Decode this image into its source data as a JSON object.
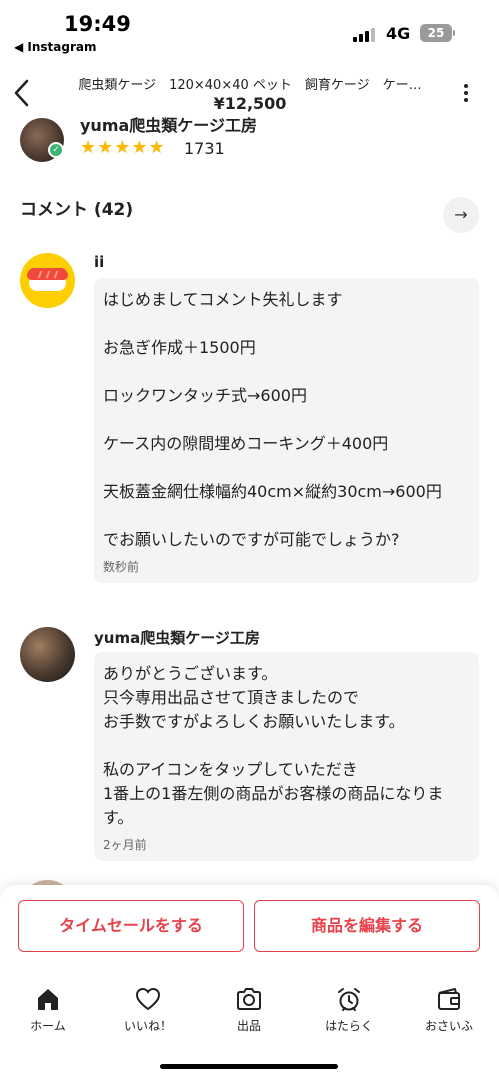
{
  "status_bar": {
    "time": "19:49",
    "back_app": "◀ Instagram",
    "network": "4G",
    "battery": "25"
  },
  "header": {
    "title": "爬虫類ケージ　120×40×40 ペット　飼育ケージ　ケー…",
    "price": "¥12,500"
  },
  "seller": {
    "name": "yuma爬虫類ケージ工房",
    "stars": "★★★★★",
    "rating_count": "1731"
  },
  "comments_section": {
    "title": "コメント (42)",
    "items": [
      {
        "name": "ii",
        "text": "はじめましてコメント失礼します\n\nお急ぎ作成＋1500円\n\nロックワンタッチ式→600円\n\nケース内の隙間埋めコーキング＋400円\n\n天板蓋金網仕様幅約40cm×縦約30cm→600円\n\nでお願いしたいのですが可能でしょうか?",
        "time": "数秒前"
      },
      {
        "name": "yuma爬虫類ケージ工房",
        "text": "ありがとうございます。\n只今専用出品させて頂きましたので\nお手数ですがよろしくお願いいたします。\n\n私のアイコンをタップしていただき\n1番上の1番左側の商品がお客様の商品になります。",
        "time": "2ヶ月前"
      }
    ]
  },
  "actions": {
    "time_sale": "タイムセールをする",
    "edit_item": "商品を編集する"
  },
  "tabs": [
    {
      "label": "ホーム",
      "icon": "home-icon"
    },
    {
      "label": "いいね！",
      "icon": "heart-icon"
    },
    {
      "label": "出品",
      "icon": "camera-icon"
    },
    {
      "label": "はたらく",
      "icon": "alarm-clock-icon"
    },
    {
      "label": "おさいふ",
      "icon": "wallet-icon"
    }
  ],
  "colors": {
    "accent": "#e8414a",
    "star": "#ffb800",
    "bubble": "#f4f4f4"
  }
}
